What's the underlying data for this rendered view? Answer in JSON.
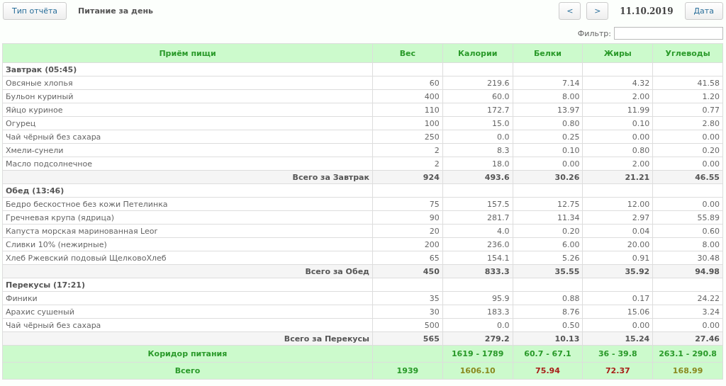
{
  "toolbar": {
    "report_type_button": "Тип отчёта",
    "report_title": "Питание за день",
    "prev_button": "<",
    "next_button": ">",
    "date": "11.10.2019",
    "date_button": "Дата"
  },
  "filter": {
    "label": "Фильтр:"
  },
  "table": {
    "columns": [
      "Приём пищи",
      "Вес",
      "Калории",
      "Белки",
      "Жиры",
      "Углеводы"
    ],
    "meals": [
      {
        "title": "Завтрак (05:45)",
        "items": [
          {
            "cells": [
              "Овсяные хлопья",
              "60",
              "219.6",
              "7.14",
              "4.32",
              "41.58"
            ]
          },
          {
            "cells": [
              "Бульон куриный",
              "400",
              "60.0",
              "8.00",
              "2.00",
              "1.20"
            ]
          },
          {
            "cells": [
              "Яйцо куриное",
              "110",
              "172.7",
              "13.97",
              "11.99",
              "0.77"
            ]
          },
          {
            "cells": [
              "Огурец",
              "100",
              "15.0",
              "0.80",
              "0.10",
              "2.80"
            ]
          },
          {
            "cells": [
              "Чай чёрный без сахара",
              "250",
              "0.0",
              "0.25",
              "0.00",
              "0.00"
            ]
          },
          {
            "cells": [
              "Хмели-сунели",
              "2",
              "8.3",
              "0.10",
              "0.80",
              "0.20"
            ]
          },
          {
            "cells": [
              "Масло подсолнечное",
              "2",
              "18.0",
              "0.00",
              "2.00",
              "0.00"
            ]
          }
        ],
        "total": [
          "Всего за Завтрак",
          "924",
          "493.6",
          "30.26",
          "21.21",
          "46.55"
        ]
      },
      {
        "title": "Обед (13:46)",
        "items": [
          {
            "cells": [
              "Бедро бескостное без кожи Петелинка",
              "75",
              "157.5",
              "12.75",
              "12.00",
              "0.00"
            ]
          },
          {
            "cells": [
              "Гречневая крупа (ядрица)",
              "90",
              "281.7",
              "11.34",
              "2.97",
              "55.89"
            ]
          },
          {
            "cells": [
              "Капуста морская маринованная Leor",
              "20",
              "4.0",
              "0.20",
              "0.04",
              "0.60"
            ]
          },
          {
            "cells": [
              "Сливки 10% (нежирные)",
              "200",
              "236.0",
              "6.00",
              "20.00",
              "8.00"
            ]
          },
          {
            "cells": [
              "Хлеб Ржевский подовый ЩелковоХлеб",
              "65",
              "154.1",
              "5.26",
              "0.91",
              "30.48"
            ]
          }
        ],
        "total": [
          "Всего за Обед",
          "450",
          "833.3",
          "35.55",
          "35.92",
          "94.98"
        ]
      },
      {
        "title": "Перекусы (17:21)",
        "items": [
          {
            "cells": [
              "Финики",
              "35",
              "95.9",
              "0.88",
              "0.17",
              "24.22"
            ]
          },
          {
            "cells": [
              "Арахис сушеный",
              "30",
              "183.3",
              "8.76",
              "15.06",
              "3.24"
            ]
          },
          {
            "cells": [
              "Чай чёрный без сахара",
              "500",
              "0.0",
              "0.50",
              "0.00",
              "0.00"
            ]
          }
        ],
        "total": [
          "Всего за Перекусы",
          "565",
          "279.2",
          "10.13",
          "15.24",
          "27.46"
        ]
      }
    ],
    "corridor": {
      "label": "Коридор питания",
      "values": [
        "1619 - 1789",
        "60.7 - 67.1",
        "36 - 39.8",
        "263.1 - 290.8"
      ]
    },
    "grand_total": [
      {
        "text": "Всего",
        "color": "#2a9a2a"
      },
      {
        "text": "1939",
        "color": "#2a9a2a"
      },
      {
        "text": "1606.10",
        "color": "#8a8a20"
      },
      {
        "text": "75.94",
        "color": "#a8201a"
      },
      {
        "text": "72.37",
        "color": "#a8201a"
      },
      {
        "text": "168.99",
        "color": "#8a8a20"
      }
    ]
  }
}
